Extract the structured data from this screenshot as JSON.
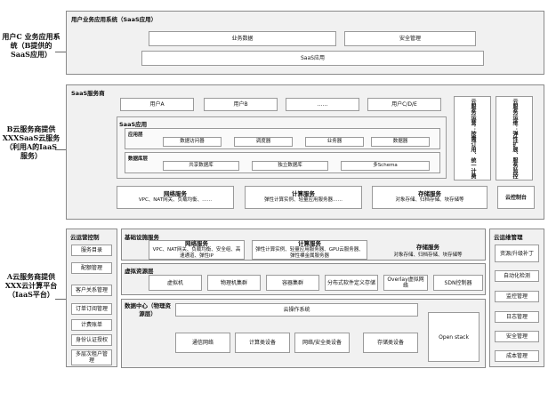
{
  "side_labels": {
    "tenant": "用户C 业务应用系统（B提供的SaaS应用）",
    "b_cloud": "B云服务商提供XXXSaaS云服务（利用A的IaaS服务）",
    "a_cloud": "A云服务商提供XXX云计算平台（IaaS平台）"
  },
  "top": {
    "title": "用户业务应用系统（SaaS应用）",
    "business_data": "业务数据",
    "security_mgmt": "安全管理",
    "saas_app": "SaaS应用"
  },
  "saas_provider": {
    "title": "SaaS服务商",
    "users": [
      "用户A",
      "用户B",
      "……",
      "用户C/D/E"
    ],
    "saas_app_title": "SaaS应用",
    "app_layer_label": "应用层",
    "app_items": [
      "数据访问器",
      "调度器",
      "业务器",
      "数据器"
    ],
    "db_layer_label": "数据库层",
    "db_items": [
      "共享数据库",
      "独立数据库",
      "多Schema"
    ],
    "mgmt_box1": "云服务运营：按需订用、统一计费",
    "mgmt_box2": "云服务运维：弹性扩展、服务监控",
    "network": {
      "title": "网络服务",
      "desc": "VPC、NAT网关、负载均衡、……"
    },
    "compute": {
      "title": "计算服务",
      "desc": "弹性计算实例、轻量应用服务器……"
    },
    "storage": {
      "title": "存储服务",
      "desc": "对象存储、归档存储、块存储等"
    },
    "console": "云控制台"
  },
  "ops_control": {
    "title": "云运营控制",
    "items": [
      "服务目录",
      "配额管理",
      "客户关系管理",
      "订单订阅管理",
      "计费账单",
      "身份认证授权",
      "多层次租户管理"
    ]
  },
  "infra": {
    "title": "基础设施服务",
    "network": {
      "title": "网络服务",
      "desc": "VPC、NAT网关、负载均衡、安全组、高速通道、弹性IP"
    },
    "compute": {
      "title": "计算服务",
      "desc": "弹性计算实例、轻量应用服务器、GPU云服务器、弹性裸金属服务器"
    },
    "storage": {
      "title": "存储服务",
      "desc": "对象存储、归档存储、块存储等"
    }
  },
  "virtual": {
    "title": "虚拟资源层",
    "items": [
      "虚拟机",
      "物理机集群",
      "容器集群",
      "分布式软件定义存储",
      "Overlay虚拟网络",
      "SDN控制器"
    ]
  },
  "datacenter": {
    "label": "数据中心（物理资源层）",
    "os": "云操作系统",
    "items": [
      "通信网络",
      "计算类设备",
      "网络/安全类设备",
      "存储类设备"
    ],
    "openstack": "Open stack"
  },
  "ops_mgmt": {
    "title": "云运维管理",
    "items": [
      "资源/升级补丁",
      "自动化检测",
      "监控管理",
      "日志管理",
      "安全管理",
      "成本管理"
    ]
  }
}
